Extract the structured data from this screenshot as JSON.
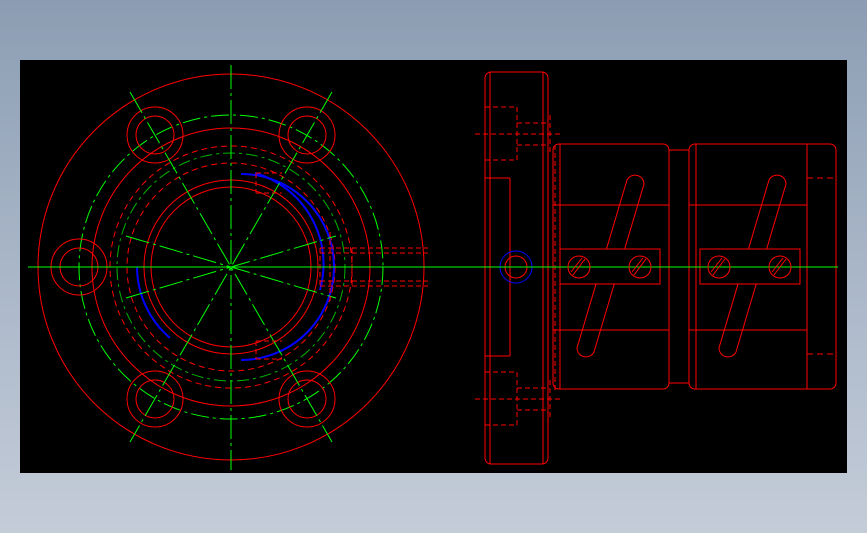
{
  "drawing": {
    "colors": {
      "background": "#000000",
      "outline": "#ff0000",
      "hidden_line": "#ff0000",
      "centerline": "#00ff00",
      "highlight": "#0000ff",
      "page_background_top": "#8c9db3",
      "page_background_bottom": "#c4ccd8"
    },
    "views": [
      {
        "name": "front-view",
        "features": [
          "outer-flange",
          "bolt-circle",
          "four-bolt-holes",
          "center-bore",
          "hidden-threads",
          "side-port"
        ]
      },
      {
        "name": "side-view",
        "features": [
          "flange-plate",
          "two-nut-sections",
          "helical-return-tubes",
          "four-slotted-screws",
          "center-axis"
        ]
      }
    ]
  }
}
